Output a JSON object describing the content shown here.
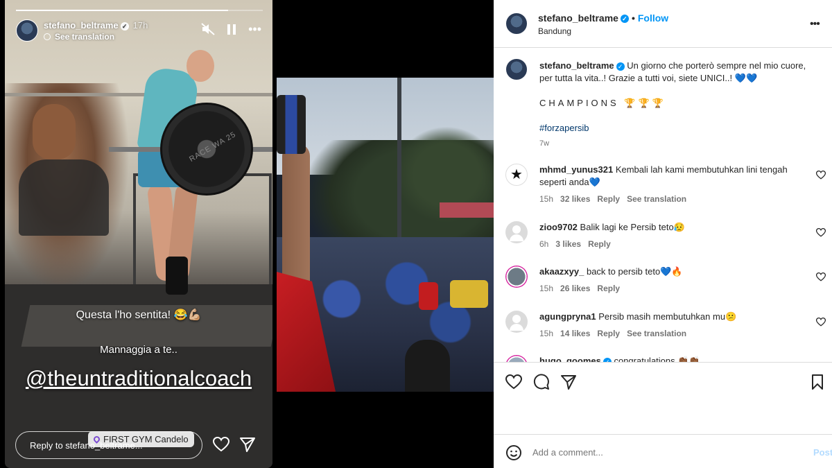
{
  "story": {
    "progress": 0.86,
    "username": "stefano_beltrame",
    "time": "17h",
    "see_translation": "See translation",
    "text1": "Questa l'ho sentita! 😂💪🏼",
    "text2": "Mannaggia a te..",
    "mention": "@theuntraditionalcoach",
    "location": "FIRST GYM Candelo",
    "reply_placeholder": "Reply to stefano_beltrame...",
    "plate_text": "RACE WA 25"
  },
  "post": {
    "header": {
      "username": "stefano_beltrame",
      "separator": "•",
      "follow_label": "Follow",
      "location": "Bandung",
      "more": "•••"
    },
    "caption": {
      "username": "stefano_beltrame",
      "text": "Un giorno che porterò sempre nel mio cuore, per tutta la vita..! Grazie a tutti voi, siete UNICI..! 💙💙",
      "line2": "CHAMPIONS 🏆🏆🏆",
      "hashtag": "#forzapersib",
      "age": "7w"
    },
    "comments": [
      {
        "username": "mhmd_yunus321",
        "text": "Kembali lah kami membutuhkan lini tengah seperti anda💙",
        "time": "15h",
        "likes": "32 likes",
        "reply": "Reply",
        "translate": "See translation"
      },
      {
        "username": "zioo9702",
        "text": "Balik lagi ke Persib teto😥",
        "time": "6h",
        "likes": "3 likes",
        "reply": "Reply",
        "translate": ""
      },
      {
        "username": "akaazxyy_",
        "text": "back to persib teto💙🔥",
        "time": "15h",
        "likes": "26 likes",
        "reply": "Reply",
        "translate": ""
      },
      {
        "username": "agungpryna1",
        "text": "Persib masih membutuhkan mu😕",
        "time": "15h",
        "likes": "14 likes",
        "reply": "Reply",
        "translate": "See translation"
      },
      {
        "username": "hugo_goomes",
        "text": "congratulations 👏🏾👏🏾",
        "time": "",
        "likes": "",
        "reply": "",
        "translate": ""
      }
    ],
    "add_comment_placeholder": "Add a comment...",
    "post_label": "Post"
  },
  "colors": {
    "accent": "#0095f6",
    "text": "#262626",
    "muted": "#737373",
    "border": "#dbdbdb"
  }
}
